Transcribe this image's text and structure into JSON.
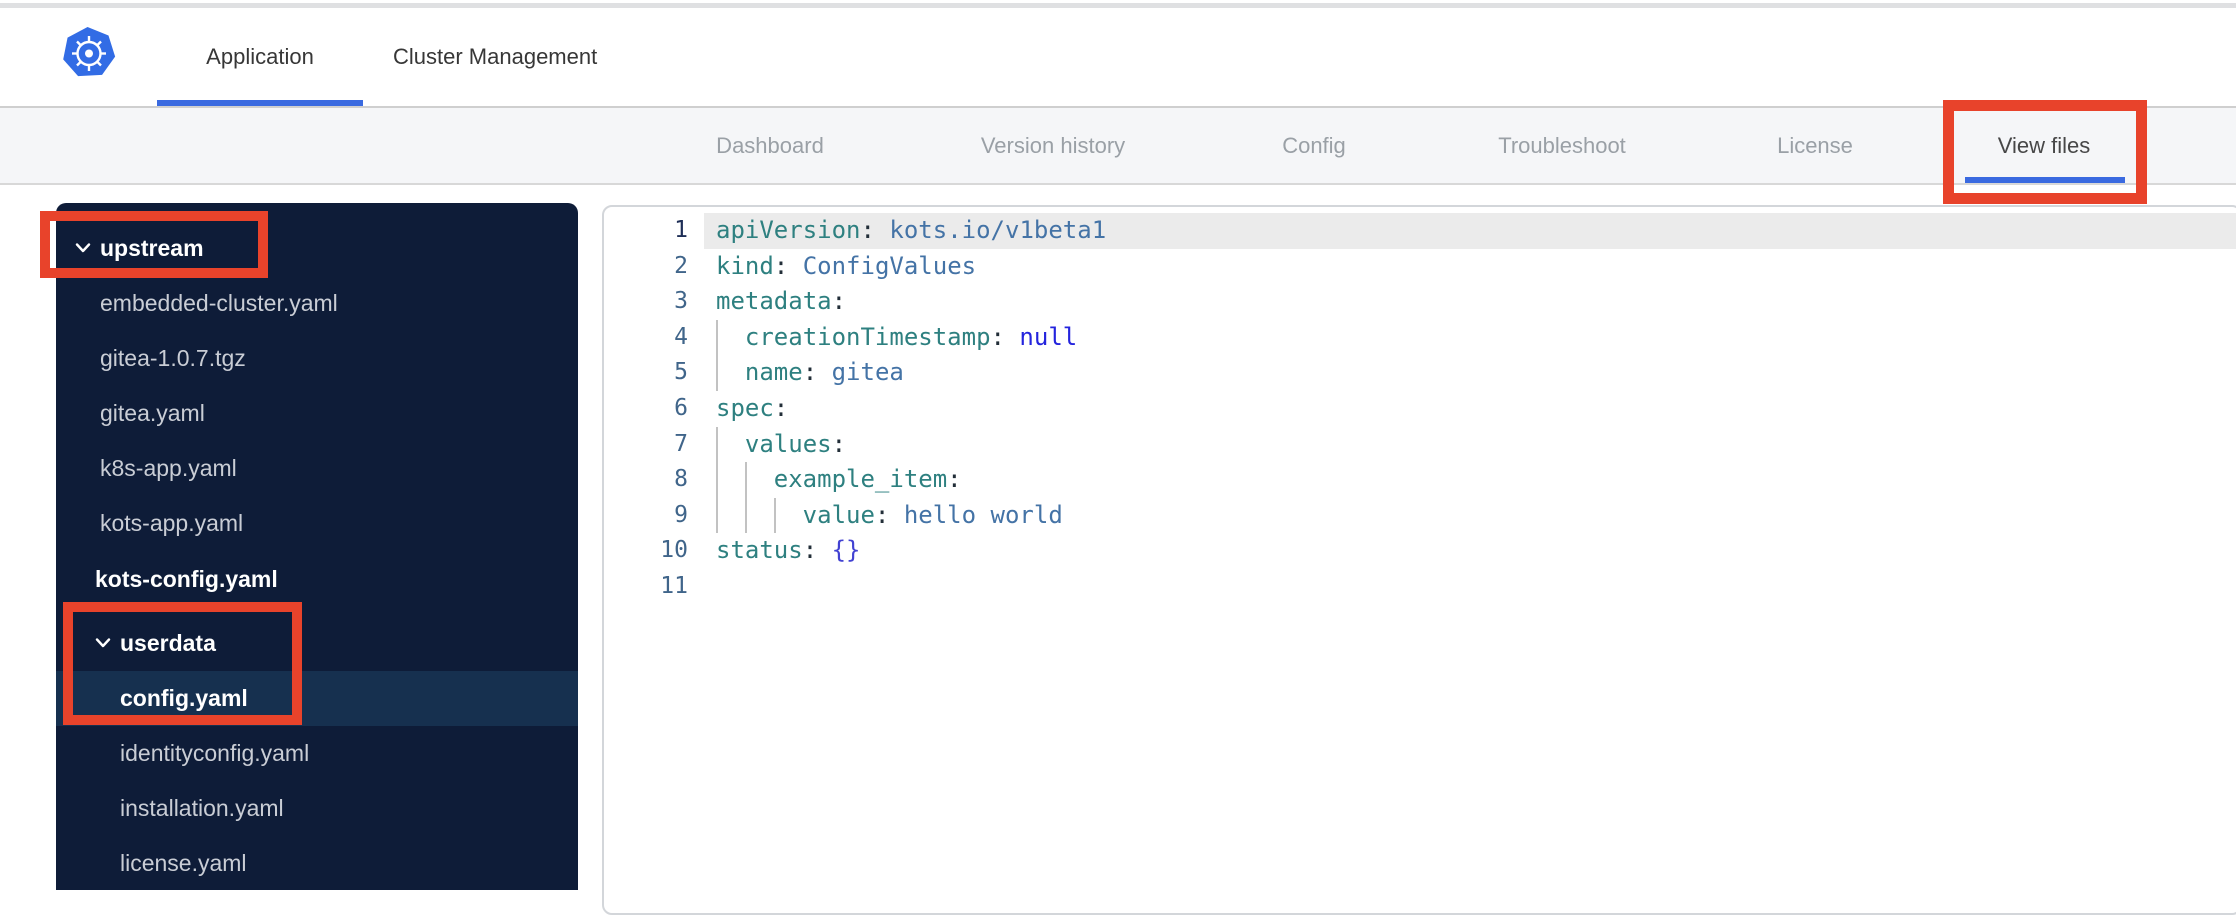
{
  "header": {
    "logo": "kubernetes-logo",
    "tabs": [
      {
        "label": "Application",
        "active": true
      },
      {
        "label": "Cluster Management",
        "active": false
      }
    ]
  },
  "nav": {
    "tabs": [
      {
        "label": "Dashboard",
        "active": false
      },
      {
        "label": "Version history",
        "active": false
      },
      {
        "label": "Config",
        "active": false
      },
      {
        "label": "Troubleshoot",
        "active": false
      },
      {
        "label": "License",
        "active": false
      },
      {
        "label": "View files",
        "active": true
      }
    ]
  },
  "sidebar": {
    "items": [
      {
        "kind": "folder",
        "label": "upstream",
        "level": 0,
        "expanded": true
      },
      {
        "kind": "file",
        "label": "embedded-cluster.yaml",
        "level": 1
      },
      {
        "kind": "file",
        "label": "gitea-1.0.7.tgz",
        "level": 1
      },
      {
        "kind": "file",
        "label": "gitea.yaml",
        "level": 1
      },
      {
        "kind": "file",
        "label": "k8s-app.yaml",
        "level": 1
      },
      {
        "kind": "file",
        "label": "kots-app.yaml",
        "level": 1
      },
      {
        "kind": "folder",
        "label": "kots-config.yaml",
        "level": 1,
        "expanded": false
      },
      {
        "kind": "folder",
        "label": "userdata",
        "level": 1,
        "expanded": true,
        "spaced": true
      },
      {
        "kind": "file",
        "label": "config.yaml",
        "level": 2,
        "selected": true
      },
      {
        "kind": "file",
        "label": "identityconfig.yaml",
        "level": 2
      },
      {
        "kind": "file",
        "label": "installation.yaml",
        "level": 2
      },
      {
        "kind": "file",
        "label": "license.yaml",
        "level": 2
      }
    ]
  },
  "editor": {
    "language": "yaml",
    "lines": [
      {
        "n": 1,
        "active": true,
        "indent": 0,
        "tokens": [
          [
            "key",
            "apiVersion"
          ],
          [
            "punct",
            ":"
          ],
          [
            "val",
            " kots.io/v1beta1"
          ]
        ]
      },
      {
        "n": 2,
        "indent": 0,
        "tokens": [
          [
            "key",
            "kind"
          ],
          [
            "punct",
            ":"
          ],
          [
            "val",
            " ConfigValues"
          ]
        ]
      },
      {
        "n": 3,
        "indent": 0,
        "tokens": [
          [
            "key",
            "metadata"
          ],
          [
            "punct",
            ":"
          ]
        ]
      },
      {
        "n": 4,
        "indent": 1,
        "tokens": [
          [
            "key",
            "creationTimestamp"
          ],
          [
            "punct",
            ":"
          ],
          [
            "const",
            " null"
          ]
        ]
      },
      {
        "n": 5,
        "indent": 1,
        "tokens": [
          [
            "key",
            "name"
          ],
          [
            "punct",
            ":"
          ],
          [
            "val",
            " gitea"
          ]
        ]
      },
      {
        "n": 6,
        "indent": 0,
        "tokens": [
          [
            "key",
            "spec"
          ],
          [
            "punct",
            ":"
          ]
        ]
      },
      {
        "n": 7,
        "indent": 1,
        "tokens": [
          [
            "key",
            "values"
          ],
          [
            "punct",
            ":"
          ]
        ]
      },
      {
        "n": 8,
        "indent": 2,
        "tokens": [
          [
            "key",
            "example_item"
          ],
          [
            "punct",
            ":"
          ]
        ]
      },
      {
        "n": 9,
        "indent": 3,
        "tokens": [
          [
            "key",
            "value"
          ],
          [
            "punct",
            ":"
          ],
          [
            "val",
            " hello world"
          ]
        ]
      },
      {
        "n": 10,
        "indent": 0,
        "tokens": [
          [
            "key",
            "status"
          ],
          [
            "punct",
            ":"
          ],
          [
            "brace",
            " {}"
          ]
        ]
      },
      {
        "n": 11,
        "indent": 0,
        "tokens": []
      }
    ]
  },
  "annotations": {
    "color": "#e8432b",
    "boxes": [
      {
        "target": "view-files-tab"
      },
      {
        "target": "upstream-folder"
      },
      {
        "target": "userdata-config-selection"
      }
    ]
  },
  "colors": {
    "accent_blue": "#3a6ae0",
    "logo_blue": "#326ce5",
    "sidebar_bg": "#0e1c38",
    "sidebar_selected": "#16304f",
    "annotation_red": "#e8432b"
  }
}
